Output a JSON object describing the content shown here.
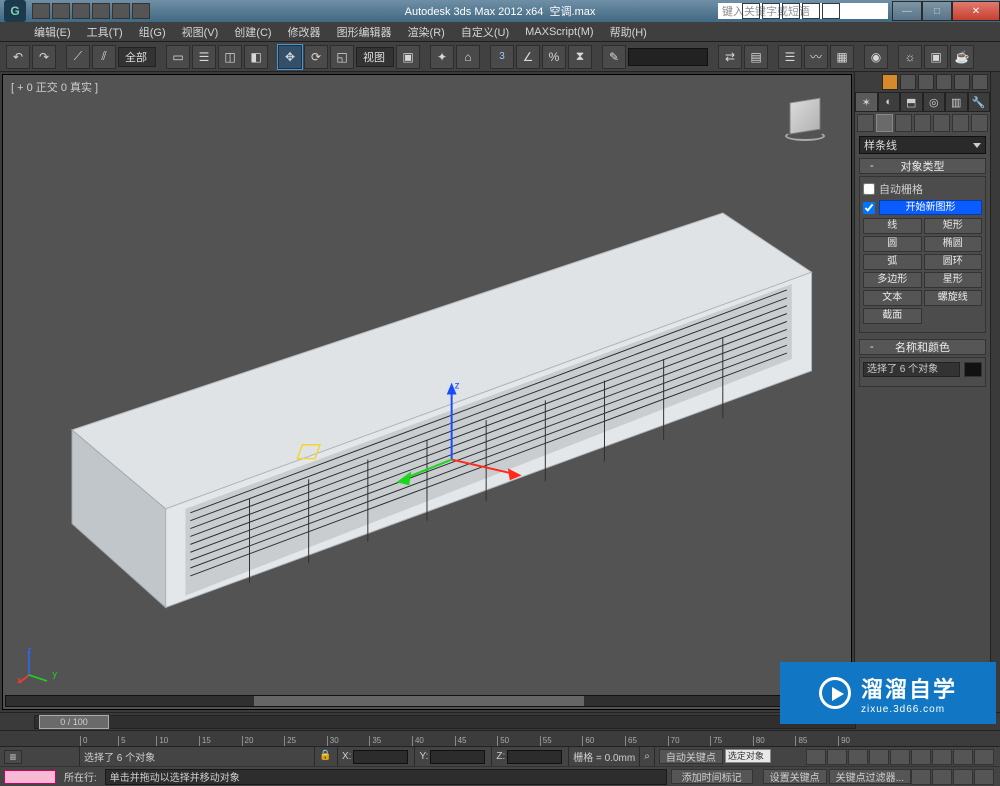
{
  "title": {
    "app": "Autodesk 3ds Max  2012  x64",
    "file": "空调.max"
  },
  "search_placeholder": "键入关键字或短语",
  "menu": [
    "编辑(E)",
    "工具(T)",
    "组(G)",
    "视图(V)",
    "创建(C)",
    "修改器",
    "图形编辑器",
    "渲染(R)",
    "自定义(U)",
    "MAXScript(M)",
    "帮助(H)"
  ],
  "scope": "全部",
  "viewport_dropdown": "视图",
  "angle_label": "3",
  "viewport_label": "[ + 0 正交 0 真实 ]",
  "panel": {
    "spline_category": "样条线",
    "rollout_type": "对象类型",
    "autogrid": "自动栅格",
    "start_new": "开始新图形",
    "shapes": [
      [
        "线",
        "矩形"
      ],
      [
        "圆",
        "椭圆"
      ],
      [
        "弧",
        "圆环"
      ],
      [
        "多边形",
        "星形"
      ],
      [
        "文本",
        "螺旋线"
      ],
      [
        "截面",
        ""
      ]
    ],
    "rollout_name": "名称和颜色",
    "name_value": "选择了 6 个对象"
  },
  "timeline": {
    "thumb": "0 / 100",
    "ticks": [
      "0",
      "5",
      "10",
      "15",
      "20",
      "25",
      "30",
      "35",
      "40",
      "45",
      "50",
      "55",
      "60",
      "65",
      "70",
      "75",
      "80",
      "85",
      "90"
    ]
  },
  "status": {
    "selected": "选择了 6 个对象",
    "x": "X:",
    "y": "Y:",
    "z": "Z:",
    "grid": "栅格 = 0.0mm",
    "autokey": "自动关键点",
    "selset": "选定对象",
    "setkey": "设置关键点",
    "keyfilter": "关键点过滤器...",
    "addtag": "添加时间标记",
    "hint": "单击并拖动以选择并移动对象",
    "row_label": "所在行:"
  },
  "watermark": {
    "big": "溜溜自学",
    "small": "zixue.3d66.com"
  }
}
